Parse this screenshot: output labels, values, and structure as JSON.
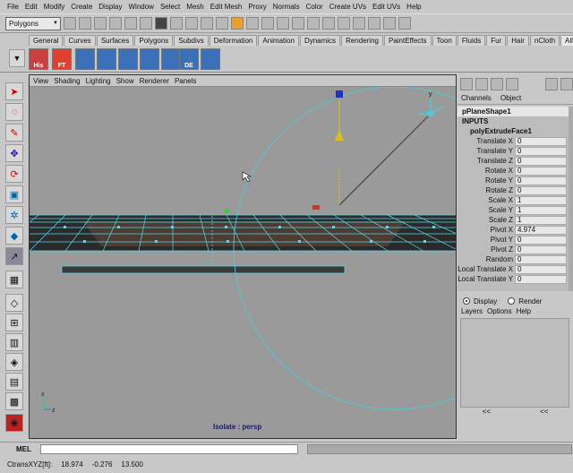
{
  "menubar": [
    "File",
    "Edit",
    "Modify",
    "Create",
    "Display",
    "Window",
    "Select",
    "Mesh",
    "Edit Mesh",
    "Proxy",
    "Normals",
    "Color",
    "Create UVs",
    "Edit UVs",
    "Help"
  ],
  "status": {
    "mode": "Polygons"
  },
  "shelf_tabs": [
    "General",
    "Curves",
    "Surfaces",
    "Polygons",
    "Subdivs",
    "Deformation",
    "Animation",
    "Dynamics",
    "Rendering",
    "PaintEffects",
    "Toon",
    "Fluids",
    "Fur",
    "Hair",
    "nCloth",
    "AlleyExt"
  ],
  "shelf_active_tab": "AlleyExt",
  "shelf_buttons": [
    "His",
    "FT",
    "",
    "",
    "",
    "",
    "",
    "DE",
    ""
  ],
  "viewport": {
    "menu": [
      "View",
      "Shading",
      "Lighting",
      "Show",
      "Renderer",
      "Panels"
    ],
    "isolate_label": "Isolate : persp",
    "axis_x": "x",
    "axis_z": "z",
    "axis_y": "y"
  },
  "channel_box": {
    "tabs": [
      "Channels",
      "Object"
    ],
    "node_name": "pPlaneShape1",
    "inputs_label": "INPUTS",
    "input_node": "polyExtrudeFace1",
    "attributes": [
      {
        "label": "Translate X",
        "value": "0"
      },
      {
        "label": "Translate Y",
        "value": "0"
      },
      {
        "label": "Translate Z",
        "value": "0"
      },
      {
        "label": "Rotate X",
        "value": "0"
      },
      {
        "label": "Rotate Y",
        "value": "0"
      },
      {
        "label": "Rotate Z",
        "value": "0"
      },
      {
        "label": "Scale X",
        "value": "1"
      },
      {
        "label": "Scale Y",
        "value": "1"
      },
      {
        "label": "Scale Z",
        "value": "1"
      },
      {
        "label": "Pivot X",
        "value": "4.974"
      },
      {
        "label": "Pivot Y",
        "value": "0"
      },
      {
        "label": "Pivot Z",
        "value": "0"
      },
      {
        "label": "Random",
        "value": "0"
      },
      {
        "label": "Local Translate X",
        "value": "0"
      },
      {
        "label": "Local Translate Y",
        "value": "0"
      }
    ]
  },
  "layers": {
    "display_label": "Display",
    "render_label": "Render",
    "menu": [
      "Layers",
      "Options",
      "Help"
    ],
    "nav_left": "<<",
    "nav_right": "<<"
  },
  "mel": {
    "label": "MEL"
  },
  "helpline": {
    "label": "CtransXYZ[ft]:",
    "x": "18.974",
    "y": "-0.276",
    "z": "13.500"
  },
  "colors": {
    "viewport_bg": "#9a9a9a",
    "wire": "#5ad8e8",
    "manip": "#4fc9d9",
    "handle_yellow": "#d8c020",
    "handle_blue": "#2030c0"
  }
}
